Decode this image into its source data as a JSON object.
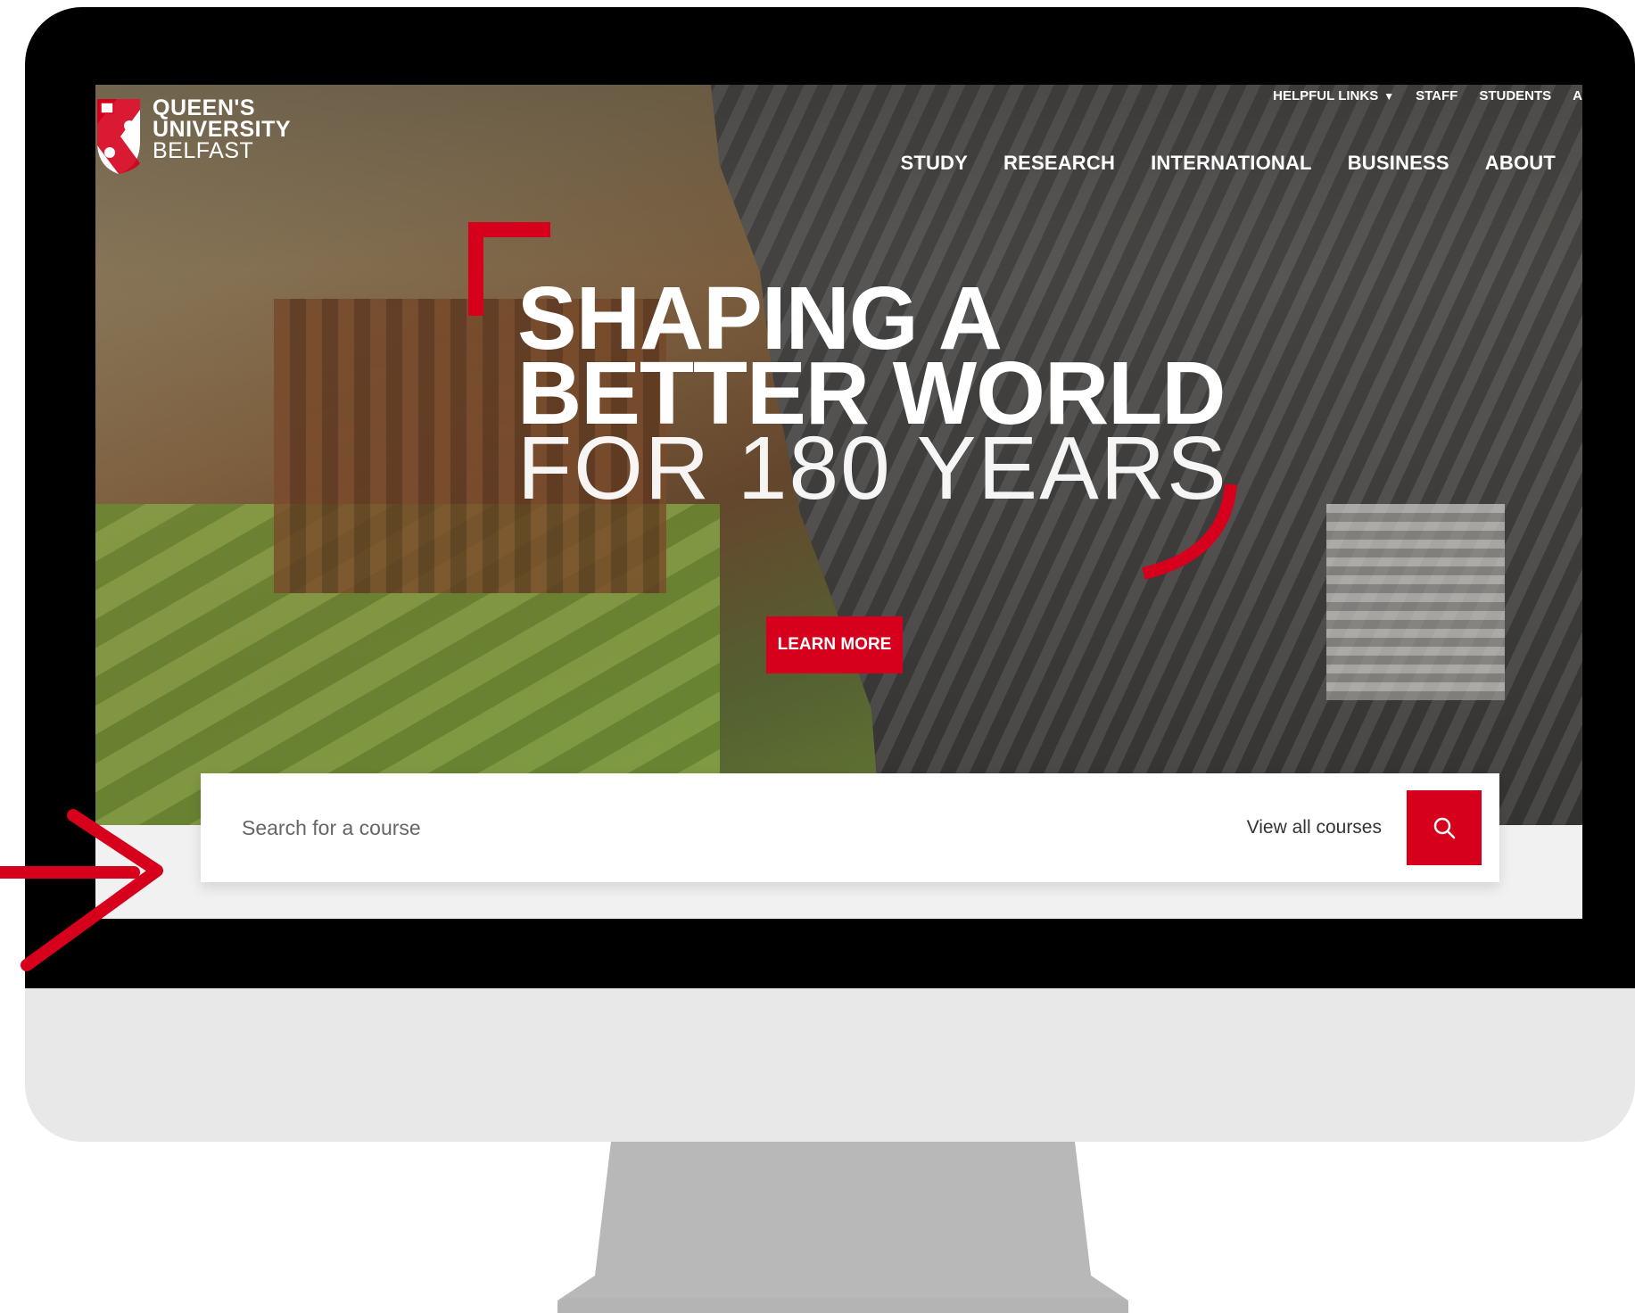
{
  "logo": {
    "line1": "QUEEN'S",
    "line2": "UNIVERSITY",
    "line3": "BELFAST",
    "crest_icon": "university-crest-icon"
  },
  "top_links": {
    "helpful_links": "HELPFUL LINKS",
    "staff": "STAFF",
    "students": "STUDENTS",
    "cut_off": "A"
  },
  "main_nav": {
    "items": [
      "STUDY",
      "RESEARCH",
      "INTERNATIONAL",
      "BUSINESS",
      "ABOUT"
    ]
  },
  "hero": {
    "line1": "SHAPING A",
    "line2": "BETTER WORLD",
    "line3": "FOR 180 YEARS",
    "cta": "LEARN MORE"
  },
  "search": {
    "placeholder": "Search for a course",
    "view_all": "View all courses",
    "icon": "search-icon"
  },
  "colors": {
    "brand_red": "#d6001c",
    "bezel": "#000000",
    "chin": "#e8e8e8",
    "stand": "#b8b8b8"
  }
}
